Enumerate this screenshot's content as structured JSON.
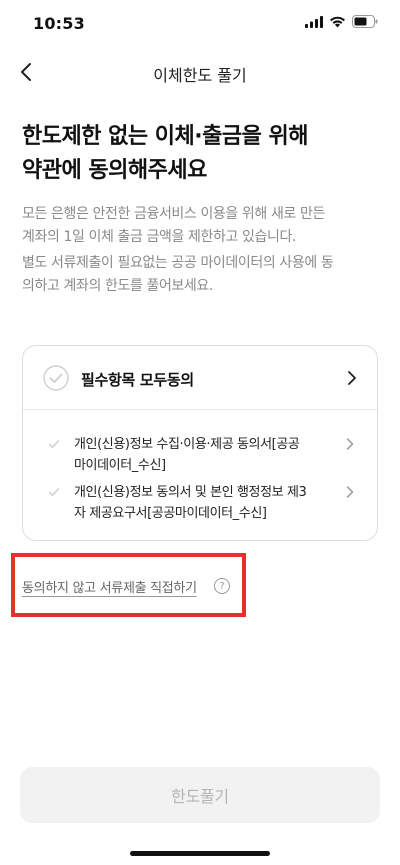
{
  "status_bar": {
    "time": "10:53",
    "icons": [
      "signal-icon",
      "wifi-icon",
      "battery-icon"
    ]
  },
  "header": {
    "title": "이체한도 풀기",
    "back_icon": "chevron-left-icon"
  },
  "headline": {
    "line1": "한도제한 없는 이체·출금을 위해",
    "line2": "약관에 동의해주세요"
  },
  "description": {
    "p1_line1": "모든 은행은 안전한 금융서비스 이용을 위해 새로 만든",
    "p1_line2": "계좌의 1일 이체 출금 금액을 제한하고 있습니다.",
    "p2_line1": "별도 서류제출이 필요없는 공공 마이데이터의 사용에 동",
    "p2_line2": "의하고 계좌의 한도를 풀어보세요."
  },
  "agreement": {
    "all_label": "필수항목 모두동의",
    "terms": [
      {
        "line1": "개인(신용)정보 수집·이용·제공 동의서[공공",
        "line2": "마이데이터_수신]"
      },
      {
        "line1": "개인(신용)정보 동의서 및 본인 행정정보 제3",
        "line2": "자 제공요구서[공공마이데이터_수신]"
      }
    ]
  },
  "direct_submit": {
    "label": "동의하지 않고 서류제출 직접하기",
    "help_glyph": "?"
  },
  "cta": {
    "label": "한도풀기"
  },
  "colors": {
    "highlight": "#e5302c",
    "cta_bg": "#f2f2f2",
    "cta_text": "#b4b4b4",
    "muted_text": "#8a8a8a"
  }
}
